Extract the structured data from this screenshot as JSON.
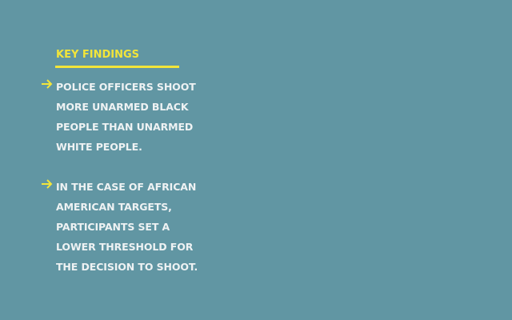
{
  "heading": "KEY FINDINGS",
  "colors": {
    "background": "#6196a3",
    "accent": "#f2e53a",
    "text": "#eef2f3"
  },
  "findings": [
    {
      "icon": "arrow-right-icon",
      "lines": [
        "POLICE OFFICERS SHOOT",
        "MORE UNARMED BLACK",
        "PEOPLE THAN UNARMED",
        "WHITE PEOPLE."
      ]
    },
    {
      "icon": "arrow-right-icon",
      "lines": [
        "IN THE CASE OF AFRICAN",
        "AMERICAN TARGETS,",
        "PARTICIPANTS SET A",
        "LOWER THRESHOLD FOR",
        "THE DECISION TO SHOOT."
      ]
    }
  ]
}
